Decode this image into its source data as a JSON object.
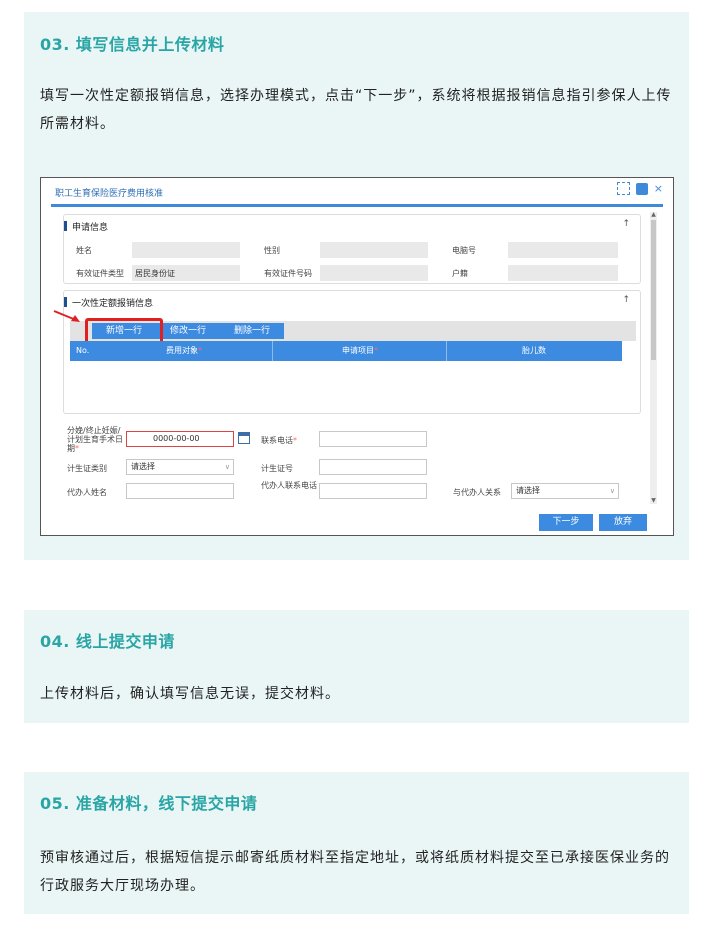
{
  "step3": {
    "title": "03. 填写信息并上传材料",
    "text": "填写一次性定额报销信息，选择办理模式，点击“下一步”，系统将根据报销信息指引参保人上传所需材料。"
  },
  "screenshot": {
    "window_title": "职工生育保险医疗费用核准",
    "section1": {
      "title": "申请信息",
      "labels": {
        "name": "姓名",
        "gender": "性别",
        "phone": "电脑号",
        "id_type": "有效证件类型",
        "id_no": "有效证件号码",
        "household": "户籍"
      },
      "values": {
        "id_type": "居民身份证"
      }
    },
    "section2": {
      "title": "一次性定额报销信息",
      "buttons": {
        "add": "新增一行",
        "edit": "修改一行",
        "delete": "删除一行"
      },
      "columns": {
        "no": "No.",
        "target": "费用对象",
        "item": "申请项目",
        "count": "胎儿数"
      }
    },
    "form": {
      "date_label": "分娩/终止妊娠/计划生育手术日期",
      "date_value": "0000-00-00",
      "contact_label": "联系电话",
      "cert_type_label": "计生证类别",
      "cert_type_value": "请选择",
      "cert_no_label": "计生证号",
      "agent_name_label": "代办人姓名",
      "agent_phone_label": "代办人联系电话",
      "relation_label": "与代办人关系",
      "relation_value": "请选择"
    },
    "actions": {
      "next": "下一步",
      "abandon": "放弃"
    }
  },
  "step4": {
    "title": "04. 线上提交申请",
    "text": "上传材料后，确认填写信息无误，提交材料。"
  },
  "step5": {
    "title": "05. 准备材料，线下提交申请",
    "text": "预审核通过后，根据短信提示邮寄纸质材料至指定地址，或将纸质材料提交至已承接医保业务的行政服务大厅现场办理。"
  },
  "colors": {
    "accent": "#2aa5a5",
    "card_bg": "#eaf6f6",
    "ui_blue": "#3c8be0",
    "highlight_red": "#e02020"
  }
}
